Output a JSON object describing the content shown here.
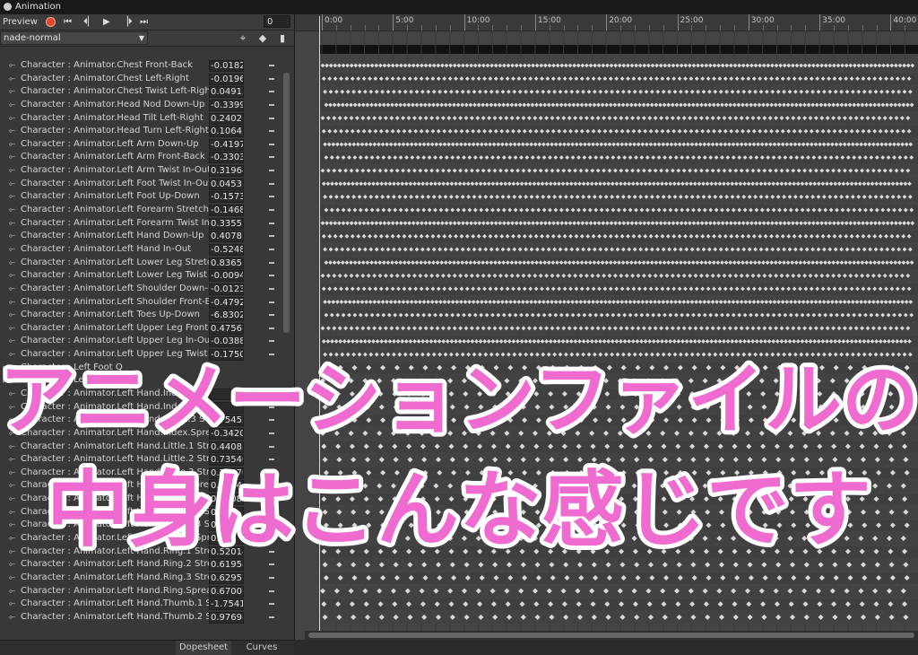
{
  "window": {
    "title": "Animation"
  },
  "toolbar": {
    "preview_label": "Preview",
    "frame_value": "0",
    "buttons": [
      "record-button",
      "first-key-button",
      "prev-key-button",
      "play-button",
      "next-key-button",
      "last-key-button"
    ]
  },
  "clip": {
    "name": "nade-normal"
  },
  "properties": [
    {
      "name": "Character : Animator.Chest Front-Back",
      "value": "-0.0182",
      "type": "curve"
    },
    {
      "name": "Character : Animator.Chest Left-Right",
      "value": "-0.0196",
      "type": "curve"
    },
    {
      "name": "Character : Animator.Chest Twist Left-Right",
      "value": "0.04913",
      "type": "curve"
    },
    {
      "name": "Character : Animator.Head Nod Down-Up",
      "value": "-0.3399",
      "type": "curve"
    },
    {
      "name": "Character : Animator.Head Tilt Left-Right",
      "value": "0.2402",
      "type": "curve"
    },
    {
      "name": "Character : Animator.Head Turn Left-Right",
      "value": "0.1064",
      "type": "curve"
    },
    {
      "name": "Character : Animator.Left Arm Down-Up",
      "value": "-0.4197",
      "type": "curve"
    },
    {
      "name": "Character : Animator.Left Arm Front-Back",
      "value": "-0.3303",
      "type": "curve"
    },
    {
      "name": "Character : Animator.Left Arm Twist In-Out",
      "value": "0.31964",
      "type": "curve"
    },
    {
      "name": "Character : Animator.Left Foot Twist In-Out",
      "value": "0.0453",
      "type": "curve"
    },
    {
      "name": "Character : Animator.Left Foot Up-Down",
      "value": "-0.1573",
      "type": "curve"
    },
    {
      "name": "Character : Animator.Left Forearm Stretch",
      "value": "-0.1468",
      "type": "curve"
    },
    {
      "name": "Character : Animator.Left Forearm Twist In-Out",
      "value": "0.3355",
      "type": "curve"
    },
    {
      "name": "Character : Animator.Left Hand Down-Up",
      "value": "0.4078",
      "type": "curve"
    },
    {
      "name": "Character : Animator.Left Hand In-Out",
      "value": "-0.5248",
      "type": "curve"
    },
    {
      "name": "Character : Animator.Left Lower Leg Stretch",
      "value": "0.8365",
      "type": "curve"
    },
    {
      "name": "Character : Animator.Left Lower Leg Twist In",
      "value": "-0.0094",
      "type": "curve"
    },
    {
      "name": "Character : Animator.Left Shoulder Down-Up",
      "value": "-0.0123",
      "type": "curve"
    },
    {
      "name": "Character : Animator.Left Shoulder Front-Back",
      "value": "-0.4792",
      "type": "curve"
    },
    {
      "name": "Character : Animator.Left Toes Up-Down",
      "value": "-6.8302",
      "type": "curve"
    },
    {
      "name": "Character : Animator.Left Upper Leg Front-Ba",
      "value": "0.47567",
      "type": "curve"
    },
    {
      "name": "Character : Animator.Left Upper Leg In-Out",
      "value": "-0.0388",
      "type": "curve"
    },
    {
      "name": "Character : Animator.Left Upper Leg Twist In-",
      "value": "-0.1750",
      "type": "curve"
    },
    {
      "name": "Character : Left Foot Q",
      "value": "",
      "type": "group"
    },
    {
      "name": "Character : Left Foot T",
      "value": "",
      "type": "group"
    },
    {
      "name": "Character : Animator.Left Hand.Index.1 Stretc",
      "value": "",
      "type": "curve"
    },
    {
      "name": "Character : Animator.Left Hand.Index.2 Stretc",
      "value": "",
      "type": "curve"
    },
    {
      "name": "Character : Animator.Left Hand.Index.3 Stretc",
      "value": "0.75452",
      "type": "curve"
    },
    {
      "name": "Character : Animator.Left Hand.Index.Spread",
      "value": "-0.3420",
      "type": "curve"
    },
    {
      "name": "Character : Animator.Left Hand.Little.1 Stretc",
      "value": "0.4408",
      "type": "curve"
    },
    {
      "name": "Character : Animator.Left Hand.Little.2 Stretc",
      "value": "0.73540",
      "type": "curve"
    },
    {
      "name": "Character : Animator.Left Hand.Little.3 Stretc",
      "value": "0.79070",
      "type": "curve"
    },
    {
      "name": "Character : Animator.Left Hand.Little.Spread",
      "value": "0.3034",
      "type": "curve"
    },
    {
      "name": "Character : Animator.Left Hand.Middle.1 Stretc",
      "value": "0.6408",
      "type": "curve"
    },
    {
      "name": "Character : Animator.Left Hand.Middle.2 Stretc",
      "value": "0.22",
      "type": "curve"
    },
    {
      "name": "Character : Animator.Left Hand.Middle.3 Stretc",
      "value": "0.66764",
      "type": "curve"
    },
    {
      "name": "Character : Animator.Left Hand.Middle.Spread",
      "value": "0.116",
      "type": "curve"
    },
    {
      "name": "Character : Animator.Left Hand.Ring.1 Stretc",
      "value": "0.52014",
      "type": "curve"
    },
    {
      "name": "Character : Animator.Left Hand.Ring.2 Stretc",
      "value": "0.61958",
      "type": "curve"
    },
    {
      "name": "Character : Animator.Left Hand.Ring.3 Stretc",
      "value": "0.62957",
      "type": "curve"
    },
    {
      "name": "Character : Animator.Left Hand.Ring.Spread",
      "value": "0.67007",
      "type": "curve"
    },
    {
      "name": "Character : Animator.Left Hand.Thumb.1 Stre",
      "value": "-1.7541",
      "type": "curve"
    },
    {
      "name": "Character : Animator.Left Hand.Thumb.2 Stre",
      "value": "0.97698",
      "type": "curve"
    }
  ],
  "timeline": {
    "ticks": [
      "0:00",
      "5:00",
      "10:00",
      "15:00",
      "20:00",
      "25:00",
      "30:00",
      "35:00",
      "40:00"
    ]
  },
  "tabs": {
    "dopesheet": "Dopesheet",
    "curves": "Curves"
  },
  "overlay_caption": {
    "line1": "アニメーションファイルの",
    "line2": "中身はこんな感じです",
    "color": "#f06bd0"
  },
  "colors": {
    "record": "#e0462b",
    "key": "#d9d9d9"
  }
}
